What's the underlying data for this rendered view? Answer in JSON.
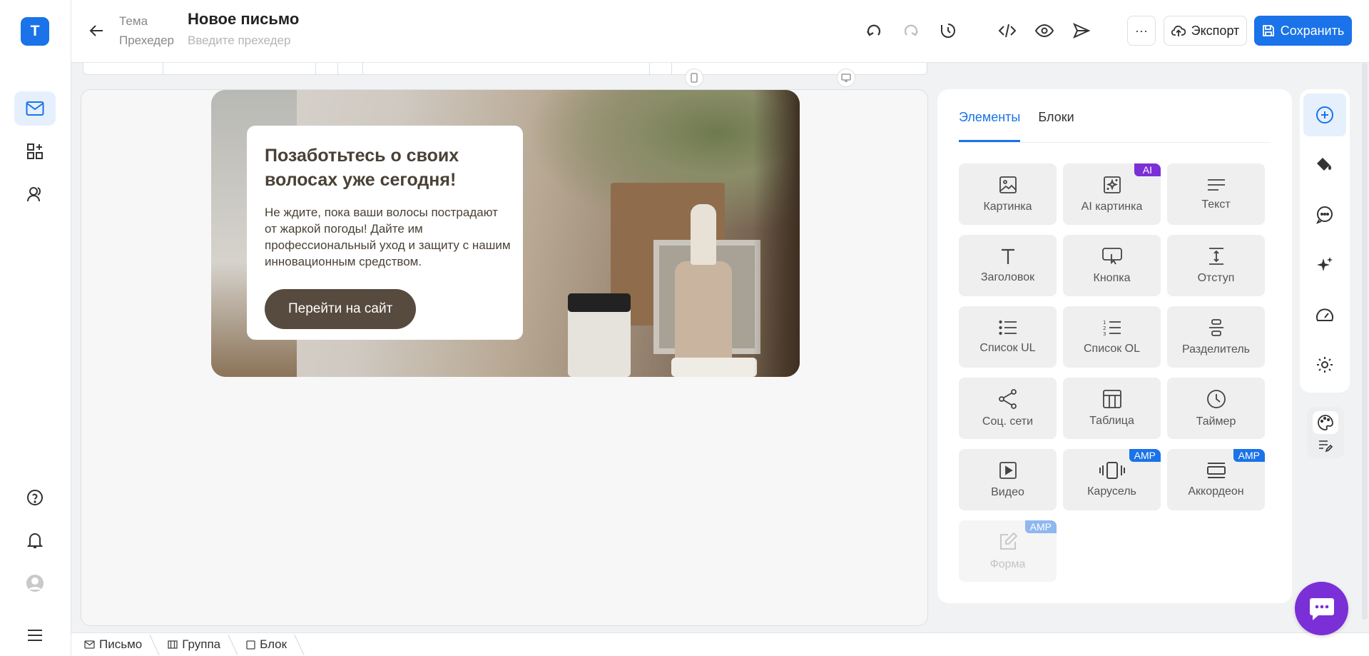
{
  "app": {
    "logo_letter": "T",
    "brand_color": "#1a73e8"
  },
  "rail": {
    "items": [
      {
        "name": "mail-icon",
        "active": true
      },
      {
        "name": "blocks-icon",
        "active": false
      },
      {
        "name": "contacts-icon",
        "active": false
      }
    ],
    "bottom": [
      "help-icon",
      "bell-icon",
      "avatar",
      "menu-icon"
    ]
  },
  "header": {
    "theme_label": "Тема",
    "preheader_label": "Прехедер",
    "subject": "Новое письмо",
    "preheader_placeholder": "Введите прехедер",
    "more_label": "···",
    "export_label": "Экспорт",
    "save_label": "Сохранить"
  },
  "email": {
    "heading": "Позаботьтесь о своих волосах уже сегодня!",
    "body": "Не ждите, пока ваши волосы пострадают от жаркой погоды! Дайте им профессиональный уход и защиту с нашим инновационным средством.",
    "cta": "Перейти на сайт"
  },
  "panel": {
    "tabs": [
      {
        "label": "Элементы",
        "active": true
      },
      {
        "label": "Блоки",
        "active": false
      }
    ],
    "elements": [
      {
        "label": "Картинка",
        "icon": "image-icon"
      },
      {
        "label": "AI картинка",
        "icon": "ai-image-icon",
        "badge": "AI"
      },
      {
        "label": "Текст",
        "icon": "text-icon"
      },
      {
        "label": "Заголовок",
        "icon": "heading-icon"
      },
      {
        "label": "Кнопка",
        "icon": "button-icon"
      },
      {
        "label": "Отступ",
        "icon": "spacer-icon"
      },
      {
        "label": "Список UL",
        "icon": "list-ul-icon"
      },
      {
        "label": "Список OL",
        "icon": "list-ol-icon"
      },
      {
        "label": "Разделитель",
        "icon": "divider-icon"
      },
      {
        "label": "Соц. сети",
        "icon": "share-icon"
      },
      {
        "label": "Таблица",
        "icon": "table-icon"
      },
      {
        "label": "Таймер",
        "icon": "clock-icon"
      },
      {
        "label": "Видео",
        "icon": "video-icon"
      },
      {
        "label": "Карусель",
        "icon": "carousel-icon",
        "badge": "AMP"
      },
      {
        "label": "Аккордеон",
        "icon": "accordion-icon",
        "badge": "AMP"
      },
      {
        "label": "Форма",
        "icon": "form-icon",
        "badge": "AMP",
        "disabled": true
      }
    ]
  },
  "breadcrumbs": [
    {
      "label": "Письмо",
      "icon": "mail-icon"
    },
    {
      "label": "Группа",
      "icon": "group-icon"
    },
    {
      "label": "Блок",
      "icon": "block-icon"
    }
  ],
  "colors": {
    "accent": "#1a73e8",
    "ai_badge": "#7b2fd6",
    "cta_bg": "#574a3e",
    "chat_bg": "#7b2fd6"
  }
}
